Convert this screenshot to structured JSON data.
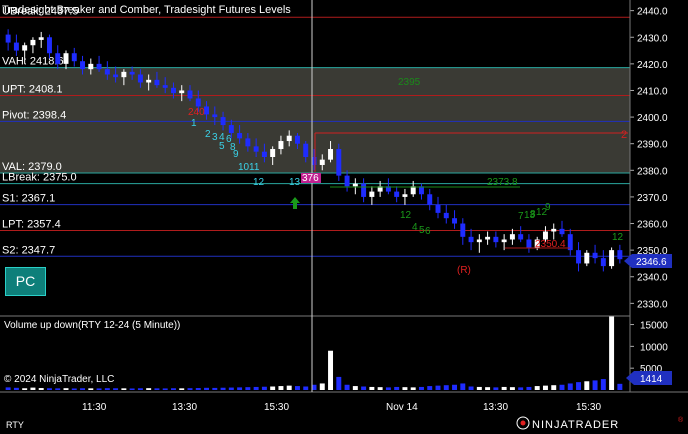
{
  "header": {
    "title": "Tradesight Breaker and Comber, Tradesight Futures Levels",
    "upper_break_label": "UBreak: 2437.5",
    "vah_label": "VAH: 2418.6"
  },
  "levels": [
    {
      "name": "UBreak",
      "label": "UBreak: 2437.5",
      "value": 2437.5,
      "color": "#b01c1c"
    },
    {
      "name": "VAH",
      "label": "VAH: 2418.6",
      "value": 2418.6,
      "color": "#2aa8a0"
    },
    {
      "name": "UPT",
      "label": "UPT: 2408.1",
      "value": 2408.1,
      "color": "#b01c1c"
    },
    {
      "name": "Pivot",
      "label": "Pivot: 2398.4",
      "value": 2398.4,
      "color": "#2030c0"
    },
    {
      "name": "VAL",
      "label": "VAL: 2379.0",
      "value": 2379.0,
      "color": "#2aa8a0"
    },
    {
      "name": "LBreak",
      "label": "LBreak: 2375.0",
      "value": 2375.0,
      "color": "#2aa8a0"
    },
    {
      "name": "S1",
      "label": "S1: 2367.1",
      "value": 2367.1,
      "color": "#2030c0"
    },
    {
      "name": "LPT",
      "label": "LPT: 2357.4",
      "value": 2357.4,
      "color": "#b01c1c"
    },
    {
      "name": "S2",
      "label": "S2: 2347.7",
      "value": 2347.7,
      "color": "#2030c0"
    }
  ],
  "annotations": {
    "green_level": "2373.8",
    "green_level_value": 2373.8,
    "red_level": "2350.4",
    "red_level_value": 2350.4,
    "r_marker": "(R)",
    "red_right_marker": "2",
    "current_price": "2346.6",
    "current_price_value": 2346.6,
    "volume_value": "1414",
    "counts_cyan": [
      "1",
      "2",
      "3",
      "4",
      "5",
      "6",
      "8",
      "9",
      "10",
      "11",
      "12",
      "13"
    ],
    "count_red": "240",
    "count_magenta": "376",
    "counts_green": [
      "12",
      "4",
      "5",
      "6",
      "7",
      "8",
      "9",
      "12",
      "13"
    ],
    "count_green_right": "12",
    "count_green_top": "2395"
  },
  "price_axis": {
    "ticks": [
      "2440.0",
      "2430.0",
      "2420.0",
      "2410.0",
      "2400.0",
      "2390.0",
      "2380.0",
      "2370.0",
      "2360.0",
      "2350.0",
      "2340.0",
      "2330.0"
    ],
    "tick_values": [
      2440,
      2430,
      2420,
      2410,
      2400,
      2390,
      2380,
      2370,
      2360,
      2350,
      2340,
      2330
    ]
  },
  "volume_panel": {
    "title": "Volume up down(RTY 12-24 (5 Minute))",
    "ticks": [
      "15000",
      "10000",
      "5000"
    ],
    "copyright": "© 2024 NinjaTrader, LLC"
  },
  "time_axis": {
    "labels": [
      "11:30",
      "13:30",
      "15:30",
      "Nov 14",
      "13:30",
      "15:30"
    ]
  },
  "footer": {
    "instrument": "RTY",
    "brand": "NINJATRADER",
    "brand_reg": "®"
  },
  "buttons": {
    "pc_label": "PC"
  },
  "colors": {
    "value_area": "#3a3a34",
    "up_candle": "#ffffff",
    "down_candle": "#1f2cff",
    "cursor_line": "#d0d0d0"
  },
  "chart_data": {
    "type": "candlestick",
    "instrument": "RTY 12-24 (5 Minute)",
    "ylim": [
      2326,
      2444
    ],
    "bars": [
      [
        2431,
        2433,
        2425,
        2428
      ],
      [
        2428,
        2431,
        2423,
        2425
      ],
      [
        2425,
        2428,
        2420,
        2427
      ],
      [
        2427,
        2430,
        2424,
        2429
      ],
      [
        2429,
        2432,
        2426,
        2430
      ],
      [
        2430,
        2431,
        2422,
        2424
      ],
      [
        2424,
        2427,
        2418,
        2420
      ],
      [
        2420,
        2425,
        2418,
        2424
      ],
      [
        2424,
        2426,
        2419,
        2421
      ],
      [
        2421,
        2423,
        2416,
        2418
      ],
      [
        2418,
        2422,
        2416,
        2420
      ],
      [
        2420,
        2423,
        2417,
        2418
      ],
      [
        2418,
        2421,
        2414,
        2416
      ],
      [
        2416,
        2419,
        2413,
        2415
      ],
      [
        2415,
        2418,
        2412,
        2417
      ],
      [
        2417,
        2419,
        2414,
        2416
      ],
      [
        2416,
        2418,
        2411,
        2413
      ],
      [
        2413,
        2416,
        2410,
        2414
      ],
      [
        2414,
        2417,
        2411,
        2412
      ],
      [
        2412,
        2415,
        2409,
        2411
      ],
      [
        2411,
        2413,
        2407,
        2409
      ],
      [
        2409,
        2412,
        2406,
        2410
      ],
      [
        2410,
        2412,
        2406,
        2407
      ],
      [
        2407,
        2410,
        2402,
        2404
      ],
      [
        2404,
        2406,
        2399,
        2401
      ],
      [
        2401,
        2404,
        2397,
        2400
      ],
      [
        2400,
        2402,
        2395,
        2397
      ],
      [
        2397,
        2399,
        2392,
        2394
      ],
      [
        2394,
        2397,
        2390,
        2392
      ],
      [
        2392,
        2394,
        2387,
        2389
      ],
      [
        2389,
        2392,
        2385,
        2387
      ],
      [
        2387,
        2390,
        2383,
        2385
      ],
      [
        2385,
        2389,
        2382,
        2388
      ],
      [
        2388,
        2393,
        2386,
        2391
      ],
      [
        2391,
        2395,
        2389,
        2393
      ],
      [
        2393,
        2394,
        2388,
        2390
      ],
      [
        2390,
        2391,
        2383,
        2385
      ],
      [
        2385,
        2388,
        2380,
        2382
      ],
      [
        2382,
        2386,
        2380,
        2384
      ],
      [
        2384,
        2391,
        2383,
        2388
      ],
      [
        2388,
        2390,
        2376,
        2378
      ],
      [
        2378,
        2380,
        2372,
        2374
      ],
      [
        2374,
        2377,
        2371,
        2375
      ],
      [
        2375,
        2377,
        2368,
        2370
      ],
      [
        2370,
        2374,
        2367,
        2372
      ],
      [
        2372,
        2376,
        2370,
        2374
      ],
      [
        2374,
        2377,
        2371,
        2372
      ],
      [
        2372,
        2374,
        2368,
        2370
      ],
      [
        2370,
        2373,
        2367,
        2371
      ],
      [
        2371,
        2376,
        2370,
        2374
      ],
      [
        2374,
        2375,
        2369,
        2371
      ],
      [
        2371,
        2373,
        2365,
        2367
      ],
      [
        2367,
        2370,
        2362,
        2364
      ],
      [
        2364,
        2367,
        2360,
        2362
      ],
      [
        2362,
        2365,
        2358,
        2360
      ],
      [
        2360,
        2362,
        2352,
        2355
      ],
      [
        2355,
        2358,
        2350,
        2353
      ],
      [
        2353,
        2356,
        2349,
        2354
      ],
      [
        2354,
        2357,
        2352,
        2355
      ],
      [
        2355,
        2357,
        2351,
        2353
      ],
      [
        2353,
        2356,
        2350,
        2354
      ],
      [
        2354,
        2358,
        2352,
        2356
      ],
      [
        2356,
        2359,
        2353,
        2354
      ],
      [
        2354,
        2356,
        2349,
        2351
      ],
      [
        2351,
        2355,
        2350,
        2354
      ],
      [
        2354,
        2359,
        2353,
        2357
      ],
      [
        2357,
        2360,
        2354,
        2358
      ],
      [
        2358,
        2361,
        2355,
        2356
      ],
      [
        2356,
        2358,
        2348,
        2350
      ],
      [
        2350,
        2353,
        2342,
        2345
      ],
      [
        2345,
        2350,
        2344,
        2349
      ],
      [
        2349,
        2352,
        2345,
        2347
      ],
      [
        2347,
        2350,
        2342,
        2344
      ],
      [
        2344,
        2351,
        2343,
        2350
      ],
      [
        2350,
        2352,
        2345,
        2346.6
      ]
    ],
    "volume": [
      600,
      500,
      400,
      550,
      450,
      400,
      380,
      420,
      350,
      400,
      380,
      360,
      420,
      400,
      380,
      350,
      400,
      420,
      380,
      360,
      400,
      380,
      420,
      450,
      500,
      480,
      520,
      560,
      600,
      650,
      700,
      750,
      800,
      900,
      1000,
      900,
      800,
      1200,
      1500,
      9000,
      3000,
      1200,
      900,
      800,
      700,
      650,
      600,
      700,
      650,
      600,
      700,
      900,
      1000,
      1100,
      1200,
      1500,
      800,
      700,
      650,
      600,
      700,
      650,
      600,
      700,
      900,
      1000,
      1100,
      1200,
      1500,
      1800,
      2000,
      2200,
      2500,
      17000,
      1414
    ]
  }
}
